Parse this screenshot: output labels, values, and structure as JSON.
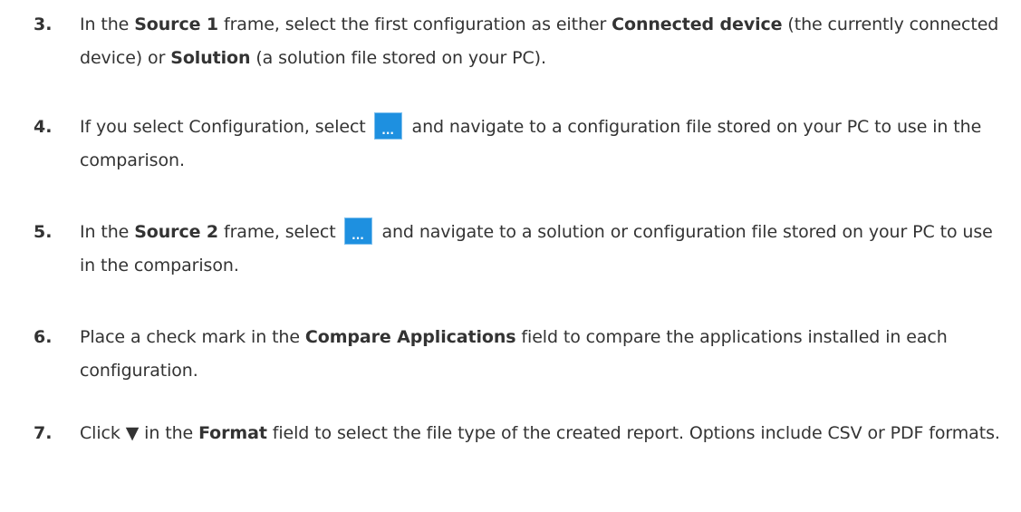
{
  "steps": [
    {
      "number": "3.",
      "parts": {
        "t1": "In the ",
        "b1": "Source 1",
        "t2": " frame, select the first configuration as either ",
        "b2": "Connected device",
        "t3": " (the currently connected device) or ",
        "b3": "Solution",
        "t4": " (a solution file stored on your PC)."
      }
    },
    {
      "number": "4.",
      "parts": {
        "t1": "If you select Configuration, select ",
        "button_icon": "ellipsis-button-icon",
        "button_label": "...",
        "t2": " and navigate to a configuration file stored on your PC to use in the comparison."
      }
    },
    {
      "number": "5.",
      "parts": {
        "t1": "In the ",
        "b1": "Source 2",
        "t2": " frame, select ",
        "button_icon": "ellipsis-button-icon",
        "button_label": "...",
        "t3": " and navigate to a solution or configuration file stored on your PC to use in the comparison."
      }
    },
    {
      "number": "6.",
      "parts": {
        "t1": "Place a check mark in the ",
        "b1": "Compare Applications",
        "t2": " field to compare the applications installed in each configuration."
      }
    },
    {
      "number": "7.",
      "parts": {
        "t1": "Click ",
        "glyph": "▼",
        "t2": " in the ",
        "b1": "Format",
        "t3": " field to select the file type of the created report. Options include CSV or PDF formats."
      }
    }
  ],
  "colors": {
    "text": "#333333",
    "button": "#1e90e0"
  }
}
